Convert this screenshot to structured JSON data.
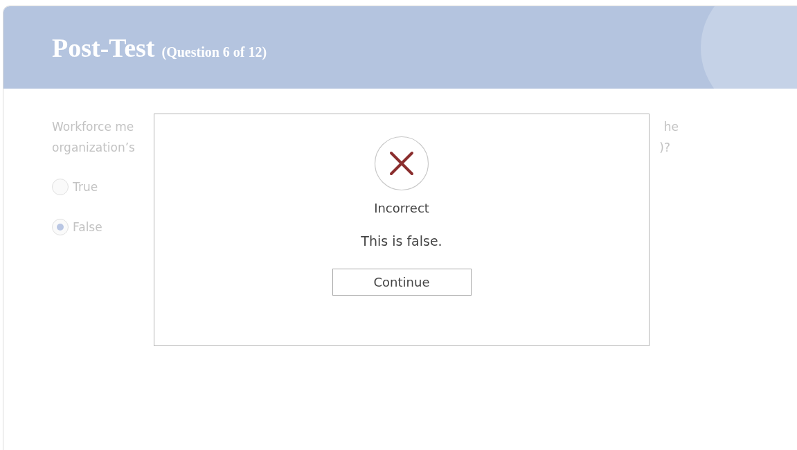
{
  "header": {
    "title": "Post-Test",
    "subtitle": "(Question 6 of 12)"
  },
  "question_lines": [
    {
      "left": "Workforce me",
      "right": "he"
    },
    {
      "left": "organization’s",
      "right": ")?"
    }
  ],
  "options": [
    {
      "label": "True",
      "selected": false
    },
    {
      "label": "False",
      "selected": true
    }
  ],
  "dialog": {
    "result": "Incorrect",
    "message": "This is false.",
    "button": "Continue"
  }
}
